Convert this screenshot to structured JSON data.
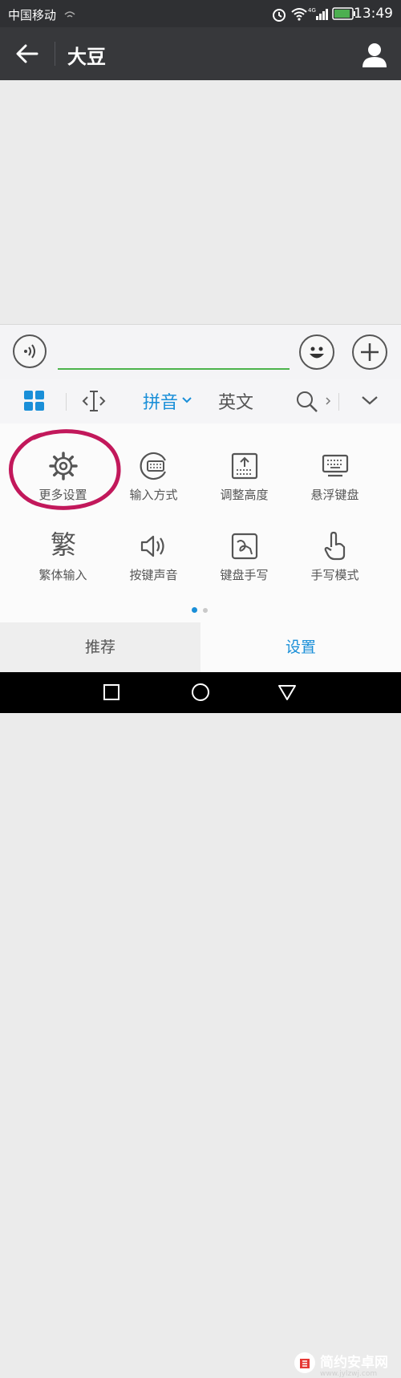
{
  "status_bar": {
    "carrier": "中国移动",
    "time": "13:49"
  },
  "header": {
    "title": "大豆"
  },
  "keyboard_toolbar": {
    "pinyin": "拼音",
    "english": "英文"
  },
  "panel": {
    "row1": [
      {
        "label": "更多设置",
        "icon": "gear-icon"
      },
      {
        "label": "输入方式",
        "icon": "keyboard-mode-icon"
      },
      {
        "label": "调整高度",
        "icon": "adjust-height-icon"
      },
      {
        "label": "悬浮键盘",
        "icon": "floating-keyboard-icon"
      }
    ],
    "row2": [
      {
        "label": "繁体输入",
        "glyph": "繁",
        "icon": "traditional-chinese-icon"
      },
      {
        "label": "按键声音",
        "icon": "speaker-icon"
      },
      {
        "label": "键盘手写",
        "icon": "keyboard-handwriting-icon"
      },
      {
        "label": "手写模式",
        "icon": "handwriting-mode-icon"
      }
    ],
    "page_indicator": {
      "pages": 2,
      "current": 1
    }
  },
  "tabs": [
    {
      "label": "推荐",
      "selected": false
    },
    {
      "label": "设置",
      "selected": true
    }
  ],
  "watermark": {
    "text": "简约安卓网",
    "url": "www.jylzwj.com"
  },
  "colors": {
    "accent": "#1a8fd8",
    "annotation": "#c2185b",
    "input_underline": "#4cb34c"
  }
}
